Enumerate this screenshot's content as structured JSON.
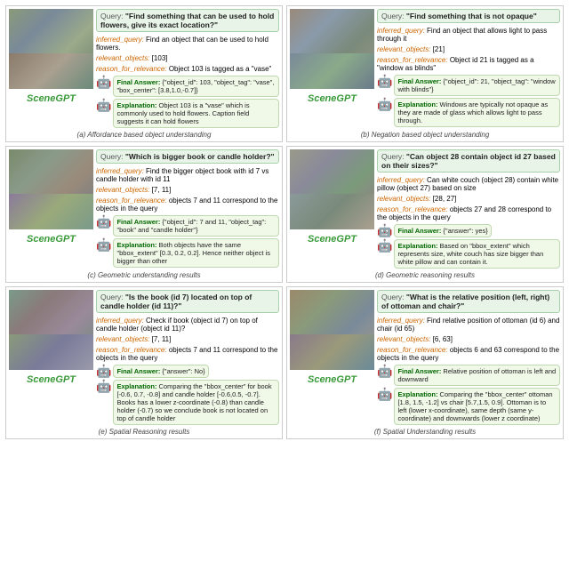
{
  "cells": [
    {
      "id": "a",
      "caption": "(a) Affordance based object understanding",
      "query": "\"Find something that can be used to hold flowers, give its exact location?\"",
      "inferred_query": "Find an object that can be used to hold flowers.",
      "relevant_objects": "[103]",
      "reason_for_relevance": "Object 103 is tagged as a \"vase\"",
      "final_answer": "{\"object_id\": 103, \"object_tag\": \"vase\", \"box_center\": [3.8,1.0,-0.7]}",
      "explanation": "Object 103 is a \"vase\" which is commonly used to hold flowers. Caption field suggests it can hold flowers",
      "scene_colors": [
        "#8a9a7a",
        "#7a8a9a",
        "#9aaa8a",
        "#6a7a6a",
        "#8a7a6a",
        "#aaa090",
        "#6a8a7a"
      ]
    },
    {
      "id": "b",
      "caption": "(b) Negation based object understanding",
      "query": "\"Find something that is not opaque\"",
      "inferred_query": "Find an object that allows light to pass through it",
      "relevant_objects": "[21]",
      "reason_for_relevance": "Object id 21 is tagged as a \"window as blinds\"",
      "final_answer": "{\"object_id\": 21, \"object_tag\": \"window with blinds\"}",
      "explanation": "Windows are typically not opaque as they are made of glass which allows light to pass through.",
      "scene_colors": [
        "#9a8a7a",
        "#8a9aaa",
        "#7a8a7a",
        "#9a9a8a",
        "#7a8a9a",
        "#8aaa8a",
        "#6a7a8a"
      ]
    },
    {
      "id": "c",
      "caption": "(c) Geometric understanding results",
      "query": "\"Which is bigger book or candle holder?\"",
      "inferred_query": "Find the bigger object book with id 7 vs candle holder with id 11",
      "relevant_objects": "[7, 11]",
      "reason_for_relevance": "objects 7 and 11 correspond to the objects in the query",
      "final_answer": "{\"object_id\": 7 and 11, \"object_tag\": \"book\" and \"candle holder\"}",
      "explanation": "Both objects have the same \"bbox_extent\" [0.3, 0.2, 0.2]. Hence neither object is bigger than other",
      "scene_colors": [
        "#7a8a6a",
        "#8a9a8a",
        "#9a8a7a",
        "#6a7a8a",
        "#8a7a9a",
        "#9aaa7a",
        "#7a9a8a"
      ]
    },
    {
      "id": "d",
      "caption": "(d) Geometric reasoning results",
      "query": "\"Can object 28 contain object id 27 based on their sizes?\"",
      "inferred_query": "Can white couch (object 28) contain white pillow (object 27) based on size",
      "relevant_objects": "[28, 27]",
      "reason_for_relevance": "objects 27 and 28 correspond to the objects in the query",
      "final_answer": "{\"answer\": yes}",
      "explanation": "Based on \"bbox_extent\" which represents size, white couch has size bigger than white pillow and can contain it.",
      "scene_colors": [
        "#9a9a8a",
        "#8a8a9a",
        "#7a9a7a",
        "#9a7a8a",
        "#8a9a9a",
        "#7a8a7a",
        "#aaa090"
      ]
    },
    {
      "id": "e",
      "caption": "(e) Spatial Reasoning results",
      "query": "\"Is the book (id 7) located on top of candle holder (id 11)?\"",
      "inferred_query": "Check if book (object id 7) on top of candle holder (object id 11)?",
      "relevant_objects": "[7, 11]",
      "reason_for_relevance": "objects 7 and 11 correspond to the objects in the query",
      "final_answer": "{\"answer\": No}",
      "explanation": "Comparing the \"bbox_center\" for book [-0.6, 0.7, -0.8] and candle holder [-0.6,0.5, -0.7]. Books has a lower z-coordinate (-0.8) than candle holder (-0.7) so we conclude book is not located on top of candle holder",
      "scene_colors": [
        "#7a9a8a",
        "#8a7a7a",
        "#9a8a9a",
        "#6a8a7a",
        "#8a9a7a",
        "#7a7a9a",
        "#9a9aaa"
      ]
    },
    {
      "id": "f",
      "caption": "(f) Spatial Understanding results",
      "query": "\"What is the relative position (left, right) of ottoman and chair?\"",
      "inferred_query": "Find relative position of ottoman (id 6) and chair (id 65)",
      "relevant_objects": "[6, 63]",
      "reason_for_relevance": "objects 6 and 63 correspond to the objects in the query",
      "final_answer": "Relative position of ottoman is left and downward",
      "explanation": "Comparing the \"bbox_center\" ottoman [1.8, 1.5, -1.2] vs chair [5.7,1.5, 0.9]. Ottoman is to left (lower x-coordinate), same depth (same y-coordinate) and downwards (lower z coordinate)",
      "scene_colors": [
        "#9a8a6a",
        "#8a9a7a",
        "#7a8a9a",
        "#aaa08a",
        "#8a7a8a",
        "#9a9a7a",
        "#6a8a9a"
      ]
    }
  ],
  "scenelabel": "SceneGPT",
  "labels": {
    "query": "Query:",
    "inferred": "inferred_query:",
    "relevant": "relevant_objects:",
    "reason": "reason_for_relevance:",
    "final": "Final Answer:",
    "explanation": "Explanation:"
  }
}
